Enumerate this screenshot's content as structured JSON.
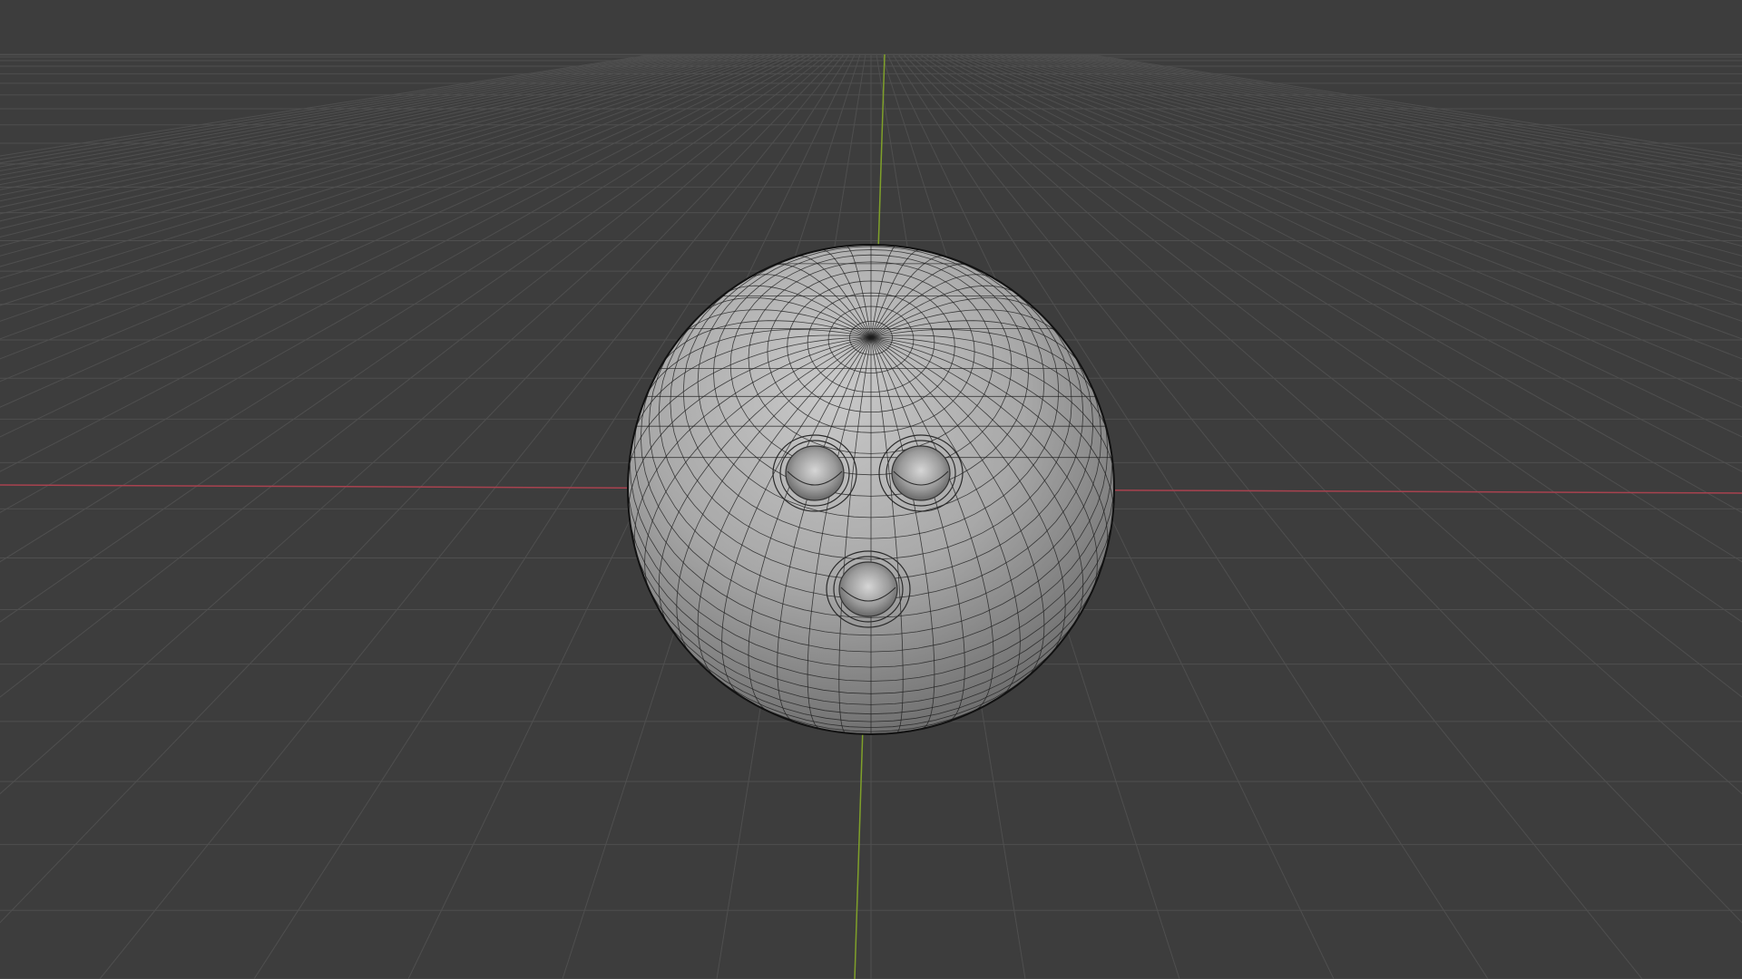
{
  "viewport": {
    "kind": "3d-viewport",
    "background_color": "#3d3d3d",
    "grid_color": "#4f4f4f",
    "x_axis_color": "#a8424f",
    "y_axis_color": "#7fa02a",
    "wireframe_color": "#1e1e1e"
  },
  "object": {
    "kind": "bowling-ball-mesh",
    "finger_holes": 3,
    "surface_color": "#a8a8a8",
    "highlight_color": "#c9c9c9",
    "shadow_color": "#6e6e6e"
  }
}
